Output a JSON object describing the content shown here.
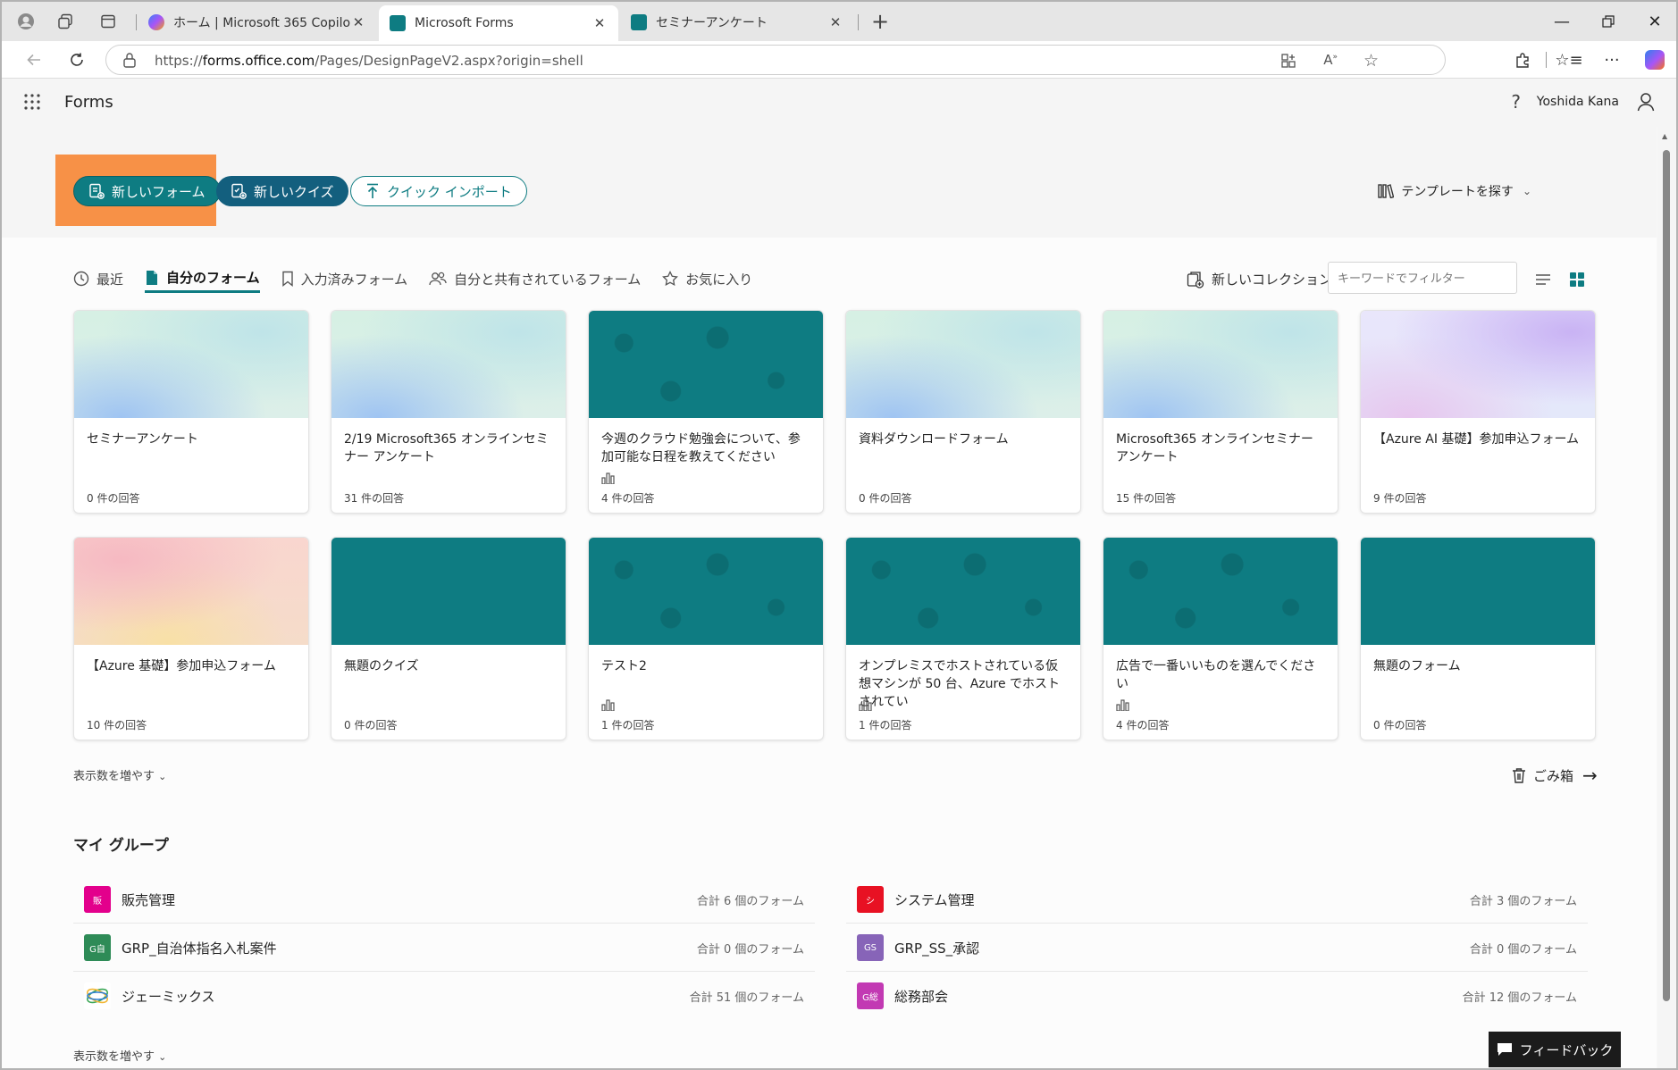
{
  "browser": {
    "tabs": [
      {
        "label": "ホーム | Microsoft 365 Copilot",
        "active": false
      },
      {
        "label": "Microsoft Forms",
        "active": true
      },
      {
        "label": "セミナーアンケート",
        "active": false
      }
    ],
    "url_prefix": "https://",
    "url_host": "forms.office.com",
    "url_path": "/Pages/DesignPageV2.aspx?origin=shell"
  },
  "app": {
    "name": "Forms",
    "help_label": "?",
    "user_name": "Yoshida Kana"
  },
  "hero": {
    "new_form_label": "新しいフォーム",
    "new_quiz_label": "新しいクイズ",
    "quick_import_label": "クイック インポート",
    "template_label": "テンプレートを探す"
  },
  "nav": {
    "recent": "最近",
    "my_forms": "自分のフォーム",
    "filled_forms": "入力済みフォーム",
    "shared_forms": "自分と共有されているフォーム",
    "favorites": "お気に入り",
    "new_collection": "新しいコレクション",
    "filter_placeholder": "キーワードでフィルター"
  },
  "cards": [
    {
      "title": "セミナーアンケート",
      "count": "0 件の回答",
      "thumb": "pastel-green",
      "bars": false
    },
    {
      "title": "2/19 Microsoft365 オンラインセミナー アンケート",
      "count": "31 件の回答",
      "thumb": "pastel-green",
      "bars": false
    },
    {
      "title": "今週のクラウド勉強会について、参加可能な日程を教えてください",
      "count": "4 件の回答",
      "thumb": "teal-pattern",
      "bars": true
    },
    {
      "title": "資料ダウンロードフォーム",
      "count": "0 件の回答",
      "thumb": "pastel-green",
      "bars": false
    },
    {
      "title": "Microsoft365 オンラインセミナー アンケート",
      "count": "15 件の回答",
      "thumb": "pastel-green",
      "bars": false
    },
    {
      "title": "【Azure AI 基礎】参加申込フォーム",
      "count": "9 件の回答",
      "thumb": "pastel-purple",
      "bars": false
    },
    {
      "title": "【Azure 基礎】参加申込フォーム",
      "count": "10 件の回答",
      "thumb": "pastel-peach",
      "bars": false
    },
    {
      "title": "無題のクイズ",
      "count": "0 件の回答",
      "thumb": "teal-plain",
      "bars": false
    },
    {
      "title": "テスト2",
      "count": "1 件の回答",
      "thumb": "teal-pattern",
      "bars": true
    },
    {
      "title": "オンプレミスでホストされている仮想マシンが 50 台、Azure でホストされてい",
      "count": "1 件の回答",
      "thumb": "teal-pattern",
      "bars": true
    },
    {
      "title": "広告で一番いいものを選んでください",
      "count": "4 件の回答",
      "thumb": "teal-pattern",
      "bars": true
    },
    {
      "title": "無題のフォーム",
      "count": "0 件の回答",
      "thumb": "teal-plain",
      "bars": false
    }
  ],
  "show_more_label": "表示数を増やす",
  "trash_label": "ごみ箱",
  "groups_title": "マイ グループ",
  "groups": [
    {
      "name": "販売管理",
      "count": "合計 6 個のフォーム",
      "badge": "販",
      "color": "#e3008c"
    },
    {
      "name": "システム管理",
      "count": "合計 3 個のフォーム",
      "badge": "シ",
      "color": "#e81123"
    },
    {
      "name": "GRP_自治体指名入札案件",
      "count": "合計 0 個のフォーム",
      "badge": "G自",
      "color": "#2e8b57"
    },
    {
      "name": "GRP_SS_承認",
      "count": "合計 0 個のフォーム",
      "badge": "GS",
      "color": "#8764b8"
    },
    {
      "name": "ジェーミックス",
      "count": "合計 51 個のフォーム",
      "badge": "",
      "color": "#ffffff"
    },
    {
      "name": "総務部会",
      "count": "合計 12 個のフォーム",
      "badge": "G総",
      "color": "#c239b3"
    }
  ],
  "feedback_label": "フィードバック",
  "colors": {
    "teal": "#0e7c82",
    "navy": "#135f7e",
    "highlight": "#f79147"
  }
}
